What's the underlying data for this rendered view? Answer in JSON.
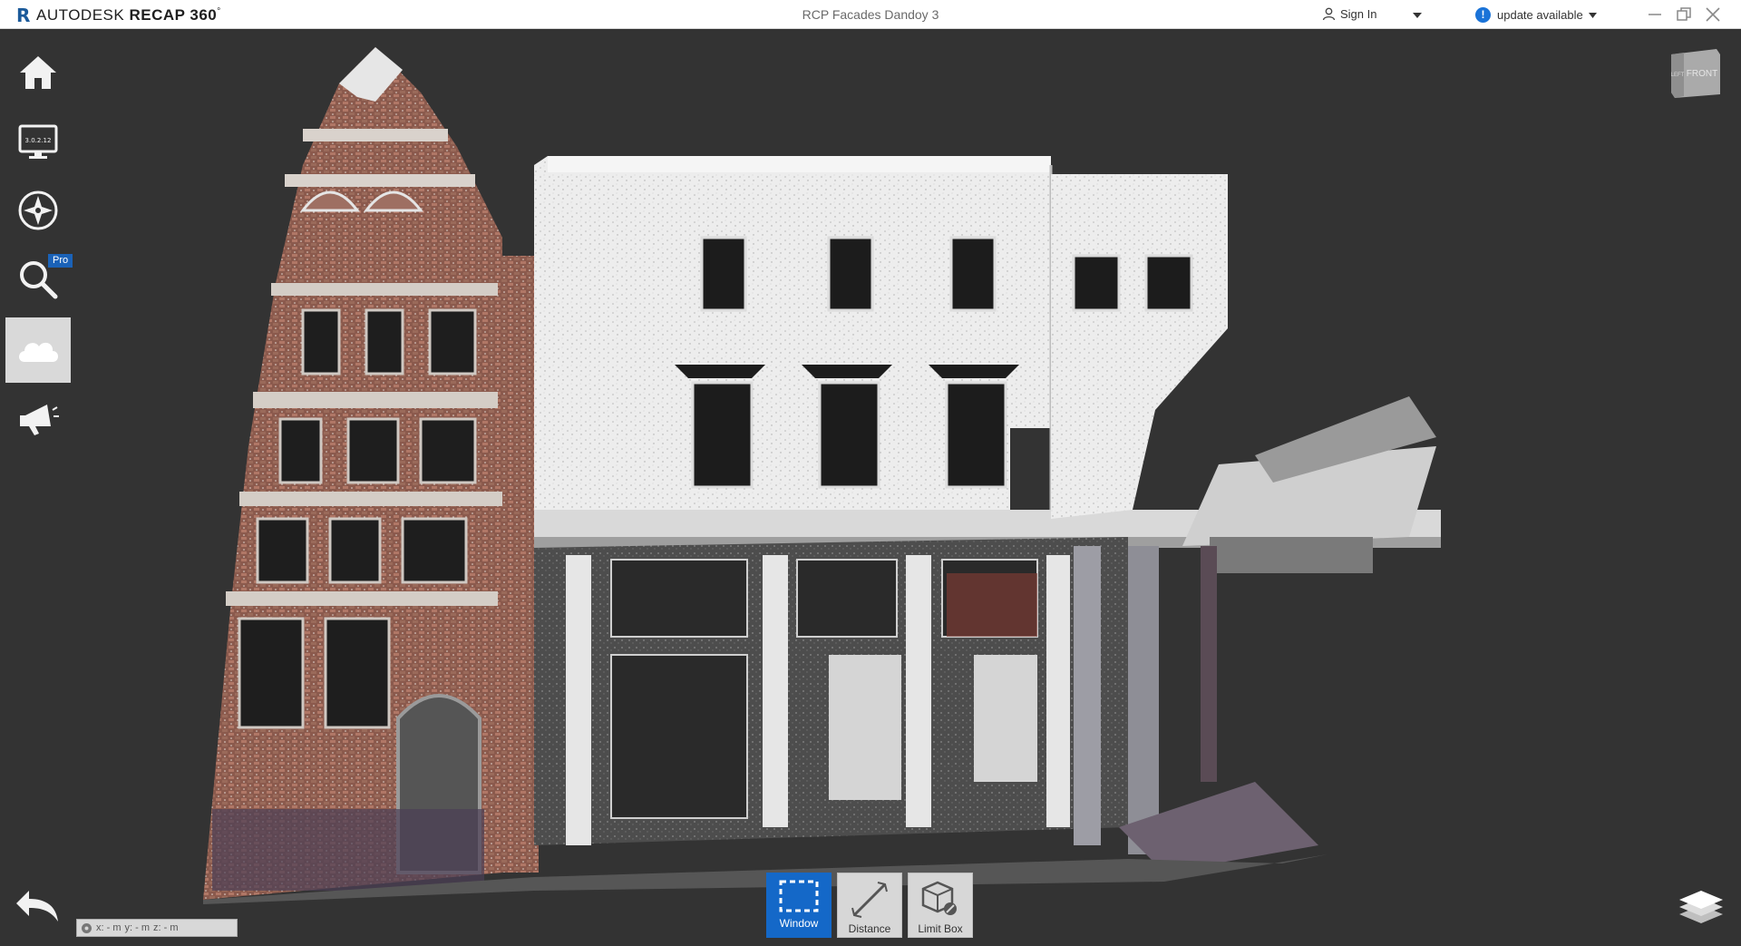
{
  "app": {
    "brand_prefix": "AUTODESK",
    "brand_product": "RECAP 360",
    "brand_mark": "°",
    "document_title": "RCP Facades Dandoy 3"
  },
  "header": {
    "signin_label": "Sign In",
    "update_label": "update available",
    "update_icon_text": "!"
  },
  "sidebar": {
    "items": [
      {
        "name": "home",
        "icon": "home-icon"
      },
      {
        "name": "display",
        "icon": "monitor-icon",
        "icon_text": "3.0.2.12"
      },
      {
        "name": "navigation",
        "icon": "compass-icon"
      },
      {
        "name": "search",
        "icon": "search-icon",
        "badge": "Pro"
      },
      {
        "name": "cloud",
        "icon": "cloud-icon",
        "active": true
      },
      {
        "name": "announce",
        "icon": "megaphone-icon"
      }
    ]
  },
  "viewcube": {
    "face_label": "FRONT",
    "side_label": "LEFT"
  },
  "tools": [
    {
      "label": "Window",
      "icon": "window-select-icon",
      "active": true
    },
    {
      "label": "Distance",
      "icon": "distance-icon",
      "active": false
    },
    {
      "label": "Limit Box",
      "icon": "limit-box-icon",
      "active": false
    }
  ],
  "coords": {
    "x": "x: - m",
    "y": "y: - m",
    "z": "z: - m"
  },
  "colors": {
    "accent": "#1468c8",
    "background": "#333333",
    "titlebar": "#ffffff"
  }
}
